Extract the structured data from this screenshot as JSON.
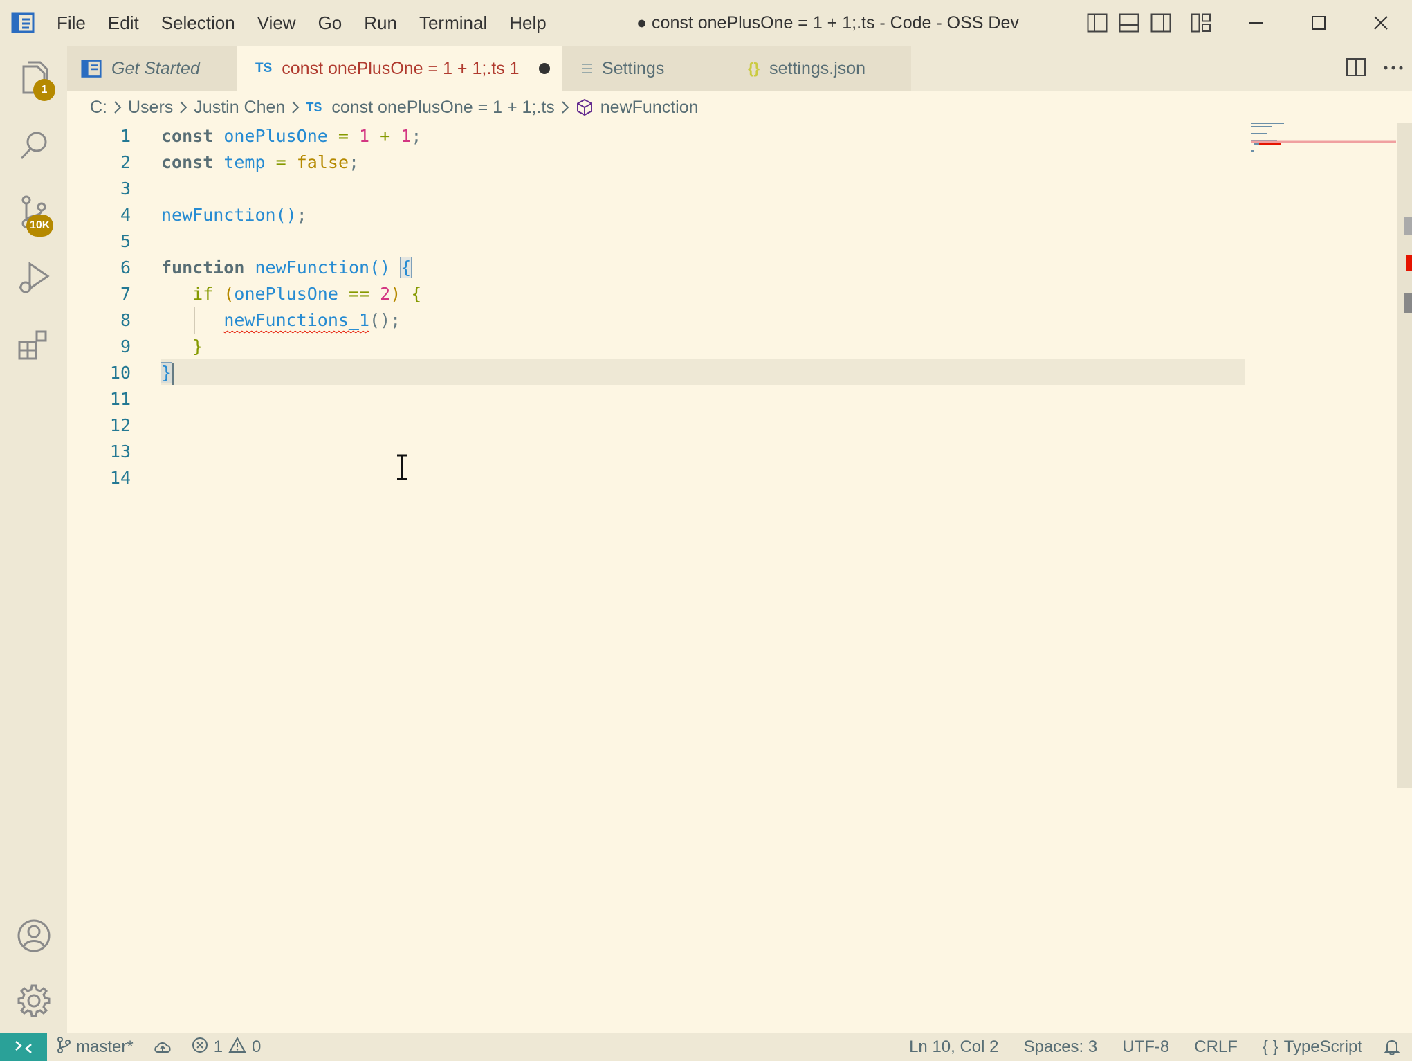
{
  "window": {
    "title": "● const onePlusOne = 1 + 1;.ts - Code - OSS Dev",
    "menu": [
      "File",
      "Edit",
      "Selection",
      "View",
      "Go",
      "Run",
      "Terminal",
      "Help"
    ]
  },
  "activity_bar": {
    "explorer_badge": "1",
    "source_control_badge": "10K"
  },
  "tabs": [
    {
      "label": "Get Started",
      "icon": "get-started-icon"
    },
    {
      "label": "const onePlusOne = 1 + 1;.ts 1",
      "icon_text": "TS",
      "dirty": true
    },
    {
      "label": "Settings",
      "icon": "settings-icon"
    },
    {
      "label": "settings.json",
      "icon_text": "{}"
    }
  ],
  "breadcrumbs": {
    "items": [
      "C:",
      "Users",
      "Justin Chen"
    ],
    "file_icon": "TS",
    "file": "const onePlusOne = 1 + 1;.ts",
    "symbol": "newFunction"
  },
  "editor": {
    "line_numbers": [
      "1",
      "2",
      "3",
      "4",
      "5",
      "6",
      "7",
      "8",
      "9",
      "10",
      "11",
      "12",
      "13",
      "14"
    ],
    "code": {
      "l1": {
        "kw": "const",
        "name": "onePlusOne",
        "eq": "=",
        "a": "1",
        "plus": "+",
        "b": "1",
        "semi": ";"
      },
      "l2": {
        "kw": "const",
        "name": "temp",
        "eq": "=",
        "val": "false",
        "semi": ";"
      },
      "l4": {
        "call": "newFunction",
        "parens": "()",
        "semi": ";"
      },
      "l6": {
        "kw": "function",
        "name": "newFunction",
        "parens": "()",
        "open": "{"
      },
      "l7": {
        "kw": "if",
        "open_paren": "(",
        "name": "onePlusOne",
        "op": "==",
        "num": "2",
        "close_paren": ")",
        "open": "{"
      },
      "l8": {
        "call": "newFunctions_1",
        "parens": "()",
        "semi": ";"
      },
      "l9": {
        "close": "}"
      },
      "l10": {
        "close": "}"
      }
    },
    "active_line": 10,
    "error_squiggle_on": "newFunctions_1"
  },
  "status_bar": {
    "branch": "master*",
    "errors": "1",
    "warnings": "0",
    "cursor_position": "Ln 10, Col 2",
    "indentation": "Spaces: 3",
    "encoding": "UTF-8",
    "eol": "CRLF",
    "language_icon": "{ }",
    "language": "TypeScript"
  },
  "colors": {
    "background": "#FDF6E3",
    "chrome": "#EEE8D5",
    "badge": "#B58900",
    "remote": "#2AA198",
    "error": "#E51400",
    "keyword": "#586E75",
    "identifier": "#268BD2",
    "number": "#D33682"
  }
}
